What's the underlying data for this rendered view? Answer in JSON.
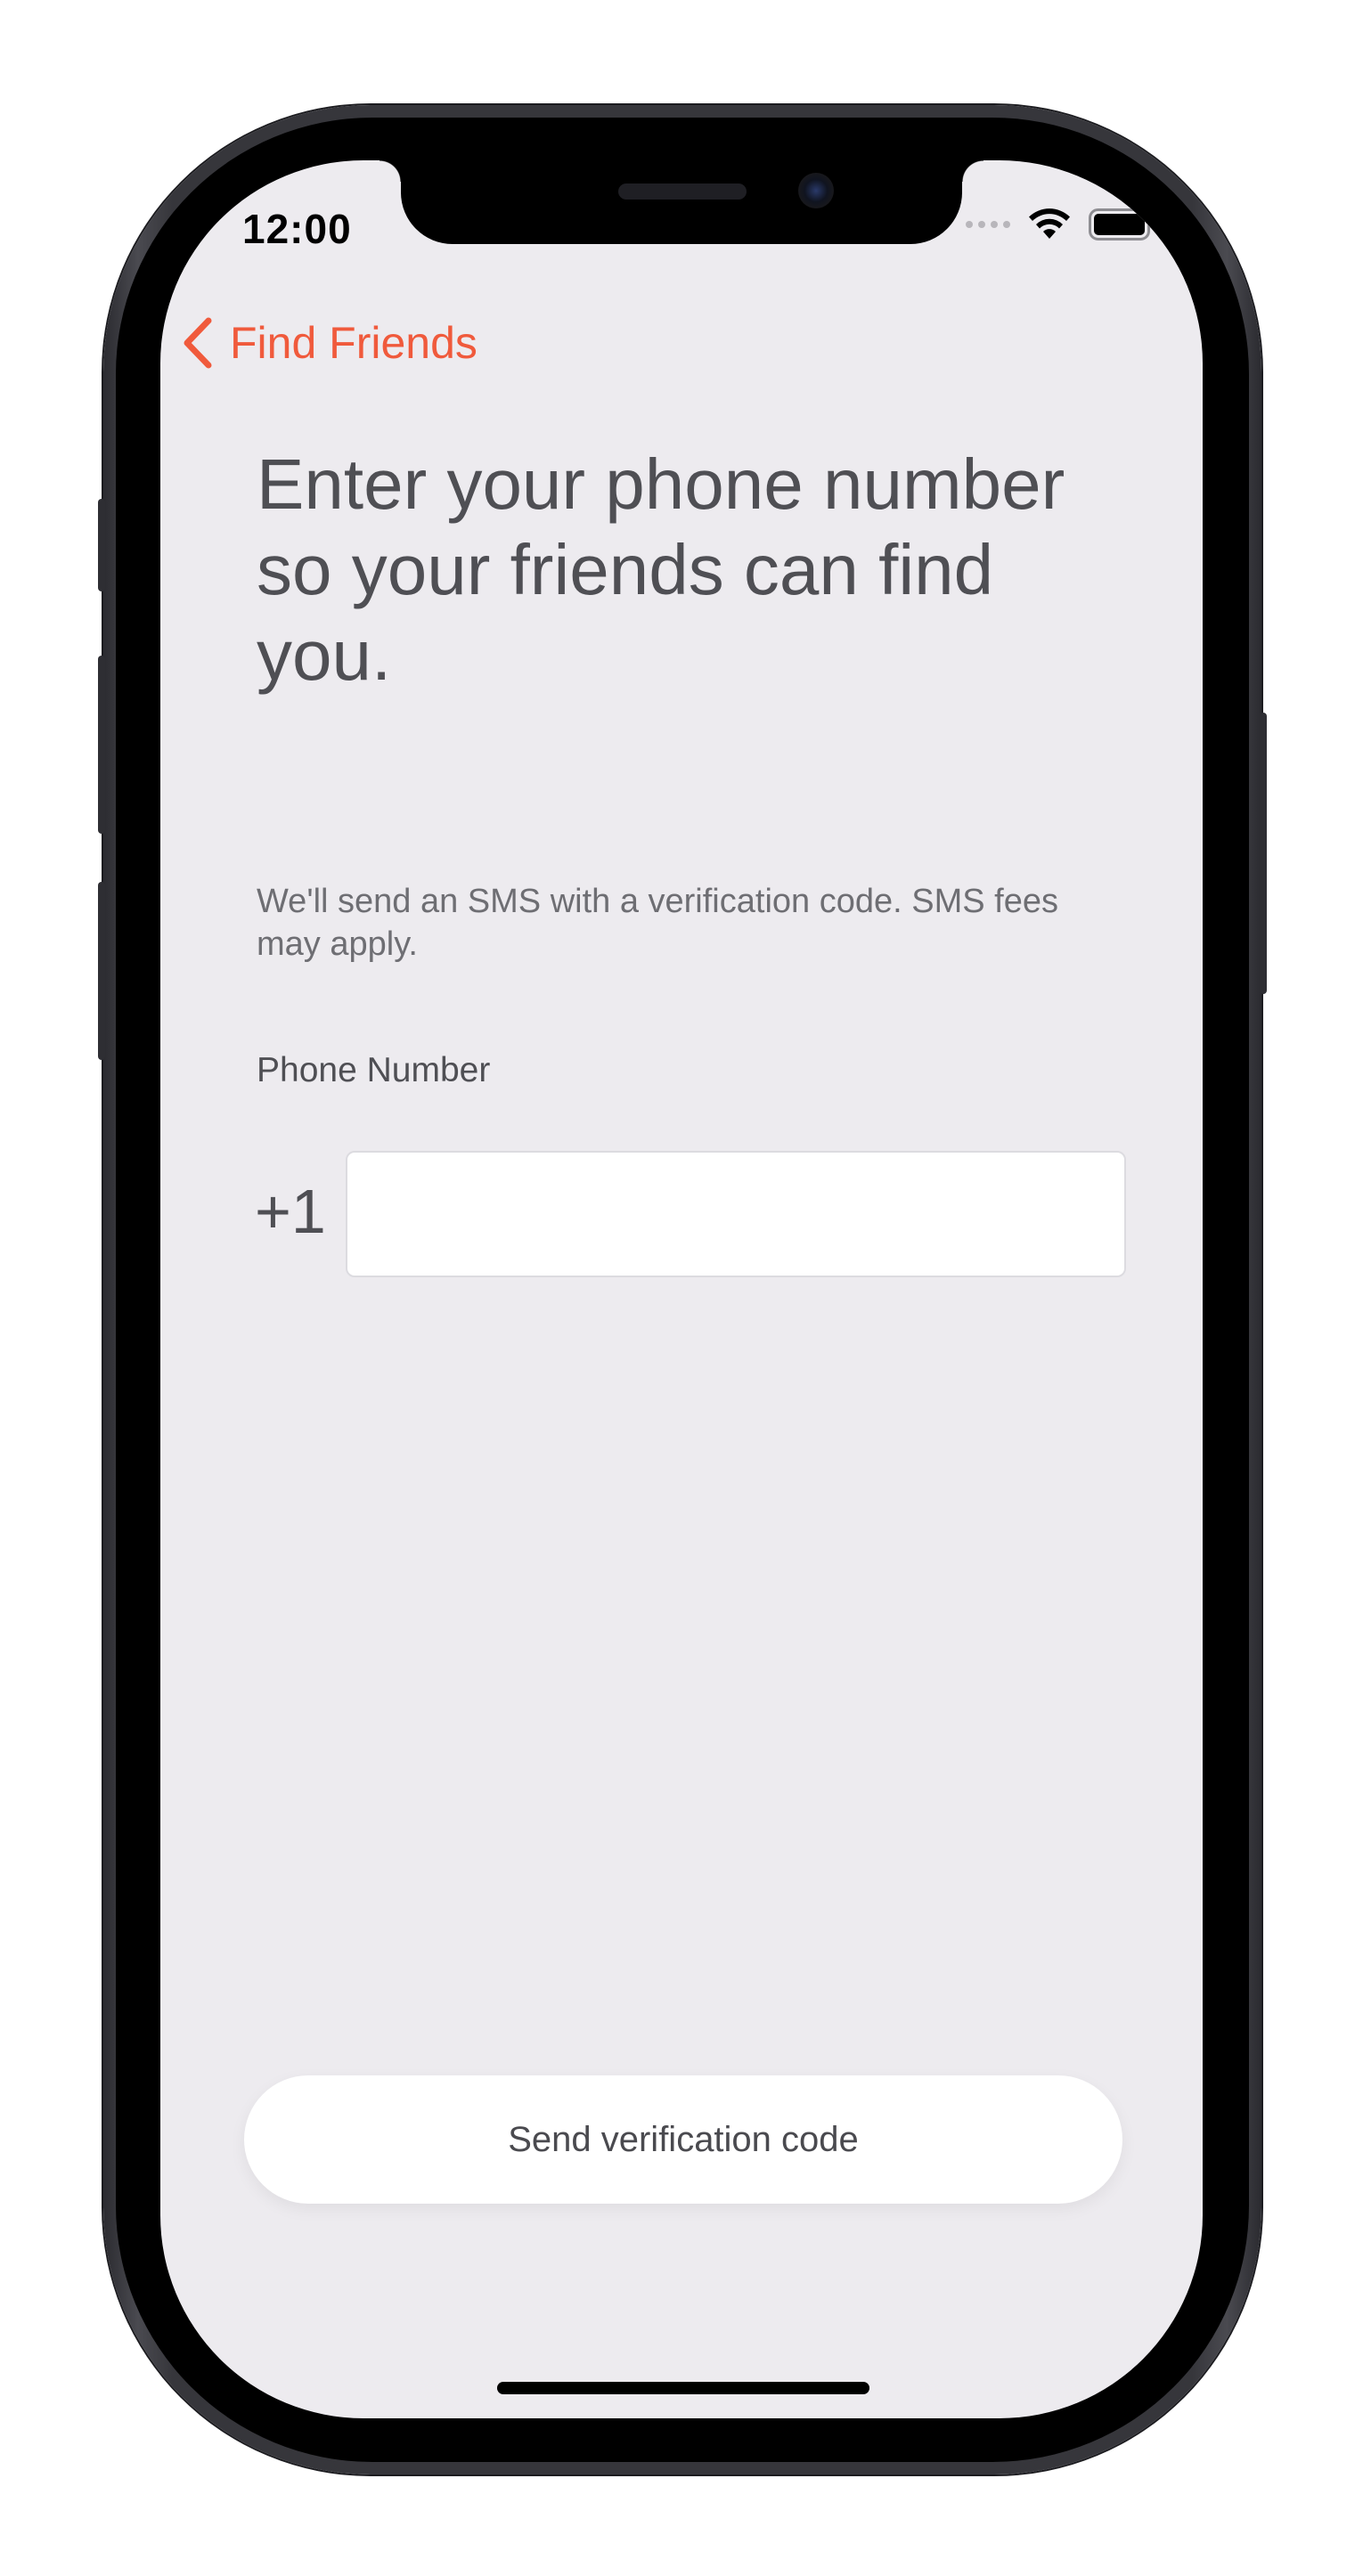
{
  "status_bar": {
    "time": "12:00"
  },
  "navigation": {
    "back_label": "Find Friends",
    "back_icon": "chevron-left-icon"
  },
  "content": {
    "headline": "Enter your phone number so your friends can find you.",
    "subtext": "We'll send an SMS with a verification code.  SMS fees may apply.",
    "phone_label": "Phone Number",
    "country_code": "+1",
    "phone_value": "",
    "phone_placeholder": ""
  },
  "actions": {
    "send_label": "Send verification code"
  },
  "colors": {
    "accent": "#f05a3c",
    "background": "#edebef",
    "text_primary": "#4f4f54",
    "text_secondary": "#6e6e73"
  }
}
